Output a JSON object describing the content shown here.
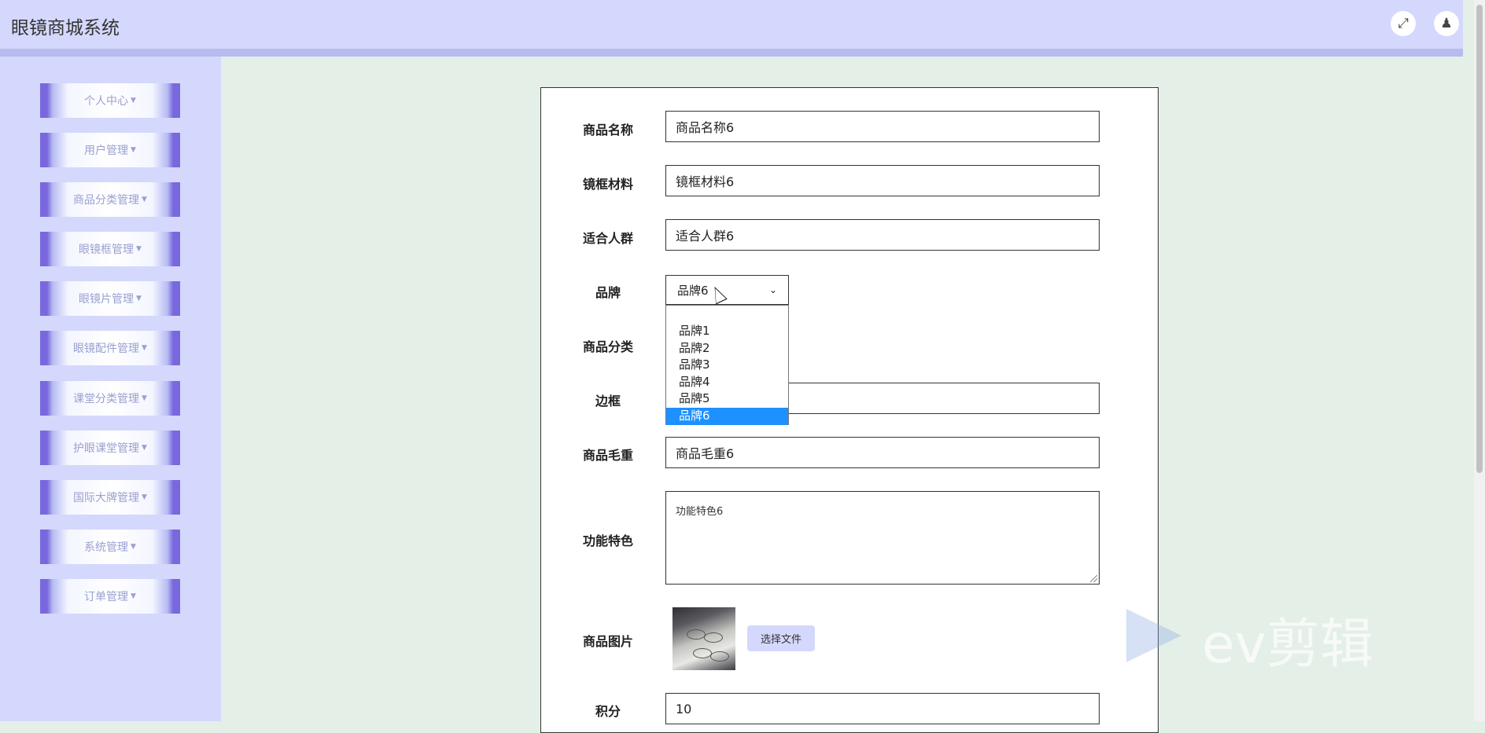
{
  "app": {
    "title": "眼镜商城系统"
  },
  "header": {
    "fullscreen_icon": "expand-icon",
    "user_icon": "user-icon"
  },
  "sidebar": {
    "items": [
      {
        "label": "个人中心"
      },
      {
        "label": "用户管理"
      },
      {
        "label": "商品分类管理"
      },
      {
        "label": "眼镜框管理"
      },
      {
        "label": "眼镜片管理"
      },
      {
        "label": "眼镜配件管理"
      },
      {
        "label": "课堂分类管理"
      },
      {
        "label": "护眼课堂管理"
      },
      {
        "label": "国际大牌管理"
      },
      {
        "label": "系统管理"
      },
      {
        "label": "订单管理"
      }
    ]
  },
  "form": {
    "product_name": {
      "label": "商品名称",
      "value": "商品名称6"
    },
    "frame_material": {
      "label": "镜框材料",
      "value": "镜框材料6"
    },
    "audience": {
      "label": "适合人群",
      "value": "适合人群6"
    },
    "brand": {
      "label": "品牌",
      "value": "品牌6",
      "options": [
        "品牌1",
        "品牌2",
        "品牌3",
        "品牌4",
        "品牌5",
        "品牌6"
      ]
    },
    "category": {
      "label": "商品分类"
    },
    "border": {
      "label": "边框"
    },
    "gross_weight": {
      "label": "商品毛重",
      "value": "商品毛重6"
    },
    "features": {
      "label": "功能特色",
      "value": "功能特色6"
    },
    "image": {
      "label": "商品图片",
      "choose_file": "选择文件"
    },
    "points": {
      "label": "积分",
      "value": "10"
    }
  },
  "watermark": {
    "text": "ev剪辑"
  },
  "colors": {
    "header_bg": "#d4d8fc",
    "content_bg": "#e4efe8",
    "menu_accent": "#7968dd",
    "selected_option": "#1e90ff"
  }
}
